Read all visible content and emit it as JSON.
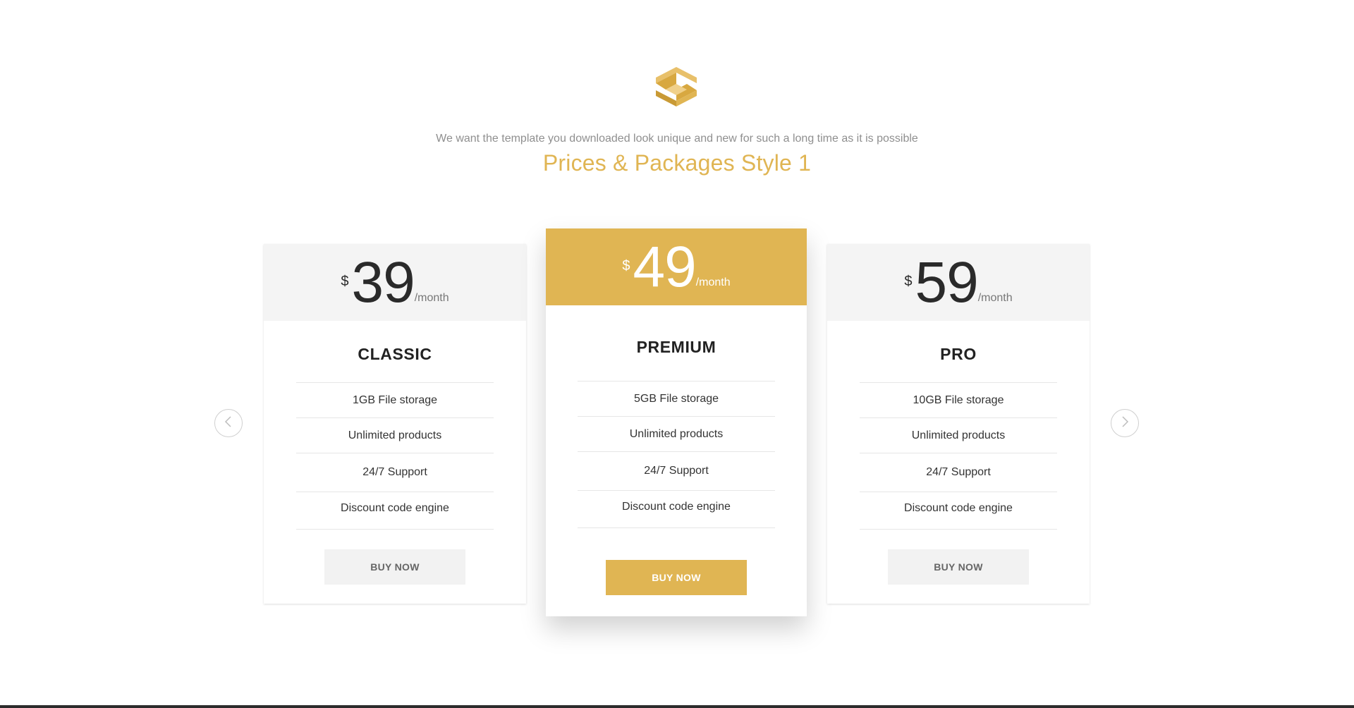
{
  "brand": {
    "logo_icon": "gold-cube-logo-icon",
    "accent_color": "#e0b553"
  },
  "section": {
    "tagline": "We want the template you downloaded look unique and new for such a long time as it is possible",
    "title": "Prices & Packages Style 1"
  },
  "plans": [
    {
      "name": "CLASSIC",
      "currency": "$",
      "price": "39",
      "period": "/month",
      "features": [
        "1GB File storage",
        "Unlimited products",
        "24/7 Support",
        "Discount code engine"
      ],
      "button": "BUY NOW",
      "featured": false
    },
    {
      "name": "PREMIUM",
      "currency": "$",
      "price": "49",
      "period": "/month",
      "features": [
        "5GB File storage",
        "Unlimited products",
        "24/7 Support",
        "Discount code engine"
      ],
      "button": "BUY NOW",
      "featured": true
    },
    {
      "name": "PRO",
      "currency": "$",
      "price": "59",
      "period": "/month",
      "features": [
        "10GB File storage",
        "Unlimited products",
        "24/7 Support",
        "Discount code engine"
      ],
      "button": "BUY NOW",
      "featured": false
    }
  ],
  "carousel": {
    "prev_icon": "chevron-left-icon",
    "next_icon": "chevron-right-icon"
  }
}
